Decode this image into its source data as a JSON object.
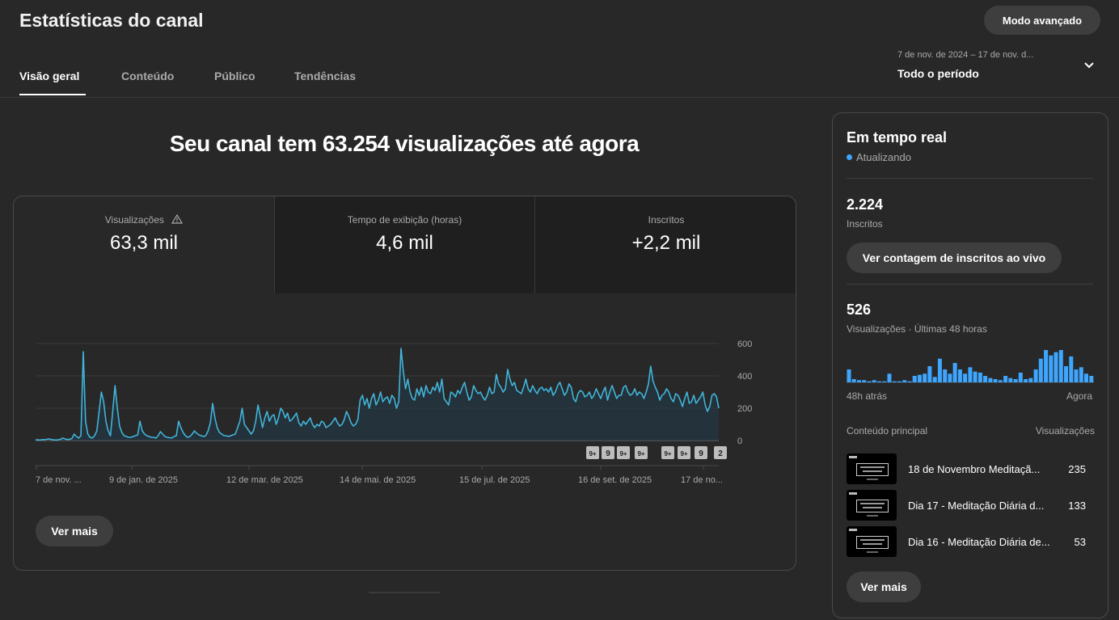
{
  "header": {
    "title": "Estatísticas do canal",
    "advanced_mode": "Modo avançado"
  },
  "tabs": [
    {
      "label": "Visão geral",
      "active": true
    },
    {
      "label": "Conteúdo",
      "active": false
    },
    {
      "label": "Público",
      "active": false
    },
    {
      "label": "Tendências",
      "active": false
    }
  ],
  "date_range": {
    "range": "7 de nov. de 2024 – 17 de nov. d...",
    "period": "Todo o período"
  },
  "headline": "Seu canal tem 63.254 visualizações até agora",
  "metrics": [
    {
      "label": "Visualizações",
      "value": "63,3 mil",
      "warning": true,
      "selected": true
    },
    {
      "label": "Tempo de exibição (horas)",
      "value": "4,6 mil",
      "warning": false,
      "selected": false
    },
    {
      "label": "Inscritos",
      "value": "+2,2 mil",
      "warning": false,
      "selected": false
    }
  ],
  "colors": {
    "accent": "#3ea6ff",
    "line": "#41b4d9",
    "background": "#282828",
    "card_dark": "#1f1f1f"
  },
  "chart_data": {
    "type": "area",
    "x_tick_labels": [
      "7 de nov. ...",
      "9 de jan. de 2025",
      "12 de mar. de 2025",
      "14 de mai. de 2025",
      "15 de jul. de 2025",
      "16 de set. de 2025",
      "17 de no..."
    ],
    "y_ticks": [
      0,
      200,
      400,
      600
    ],
    "ylim": [
      0,
      600
    ],
    "series": [
      {
        "values": [
          5,
          4,
          3,
          6,
          5,
          8,
          10,
          6,
          4,
          3,
          5,
          8,
          15,
          10,
          6,
          8,
          12,
          40,
          25,
          15,
          30,
          550,
          120,
          40,
          20,
          15,
          30,
          60,
          180,
          300,
          240,
          120,
          60,
          30,
          180,
          340,
          200,
          90,
          50,
          30,
          25,
          20,
          20,
          25,
          30,
          35,
          120,
          60,
          40,
          30,
          25,
          20,
          20,
          15,
          30,
          55,
          40,
          25,
          20,
          18,
          15,
          25,
          30,
          120,
          80,
          50,
          30,
          20,
          25,
          40,
          60,
          45,
          35,
          30,
          25,
          30,
          60,
          110,
          230,
          140,
          80,
          50,
          40,
          30,
          30,
          25,
          30,
          35,
          40,
          80,
          120,
          200,
          100,
          80,
          60,
          40,
          60,
          120,
          220,
          150,
          80,
          140,
          180,
          120,
          150,
          160,
          100,
          140,
          200,
          180,
          140,
          170,
          120,
          130,
          150,
          170,
          110,
          90,
          120,
          100,
          120,
          140,
          100,
          80,
          100,
          90,
          120,
          110,
          80,
          90,
          100,
          120,
          140,
          110,
          90,
          100,
          130,
          180,
          150,
          110,
          90,
          100,
          130,
          250,
          280,
          220,
          260,
          200,
          260,
          290,
          220,
          250,
          300,
          240,
          260,
          270,
          230,
          280,
          260,
          200,
          240,
          570,
          430,
          320,
          380,
          300,
          260,
          250,
          320,
          280,
          330,
          270,
          340,
          300,
          290,
          330,
          310,
          360,
          300,
          380,
          260,
          240,
          220,
          300,
          290,
          270,
          310,
          290,
          330,
          360,
          300,
          250,
          270,
          340,
          310,
          290,
          300,
          270,
          250,
          280,
          330,
          290,
          300,
          410,
          350,
          330,
          300,
          320,
          440,
          380,
          340,
          360,
          310,
          300,
          290,
          330,
          380,
          320,
          300,
          340,
          310,
          290,
          320,
          330,
          310,
          320,
          300,
          330,
          280,
          300,
          340,
          360,
          320,
          280,
          300,
          350,
          330,
          260,
          240,
          290,
          310,
          300,
          270,
          280,
          300,
          260,
          280,
          320,
          290,
          260,
          300,
          330,
          250,
          300,
          340,
          300,
          260,
          280,
          280,
          330,
          340,
          300,
          280,
          290,
          320,
          280,
          300,
          290,
          260,
          300,
          350,
          460,
          370,
          330,
          300,
          250,
          280,
          290,
          320,
          300,
          260,
          240,
          290,
          280,
          250,
          210,
          260,
          300,
          230,
          240,
          280,
          230,
          250,
          270,
          300,
          220,
          180,
          210,
          280,
          290,
          270,
          200
        ]
      }
    ],
    "markers": [
      "9+",
      "9",
      "9+",
      "9+",
      "9+",
      "9+",
      "9",
      "2"
    ]
  },
  "see_more": "Ver mais",
  "realtime": {
    "title": "Em tempo real",
    "status": "Atualizando",
    "subscribers_value": "2.224",
    "subscribers_label": "Inscritos",
    "live_button": "Ver contagem de inscritos ao vivo",
    "views_value": "526",
    "views_label": "Visualizações · Últimas 48 horas",
    "bars_from": "48h atrás",
    "bars_to": "Agora",
    "hourly_views": [
      12,
      3,
      2,
      2,
      1,
      2,
      1,
      1,
      8,
      1,
      1,
      2,
      1,
      6,
      7,
      8,
      15,
      5,
      22,
      12,
      8,
      18,
      12,
      8,
      14,
      10,
      9,
      6,
      4,
      3,
      2,
      6,
      4,
      3,
      9,
      3,
      4,
      12,
      22,
      30,
      25,
      28,
      30,
      15,
      24,
      12,
      14,
      8,
      6
    ],
    "content_label": "Conteúdo principal",
    "views_column": "Visualizações",
    "videos": [
      {
        "title": "18 de Novembro Meditaçã...",
        "views": "235"
      },
      {
        "title": "Dia 17 - Meditação Diária d...",
        "views": "133"
      },
      {
        "title": "Dia 16 - Meditação Diária de...",
        "views": "53"
      }
    ],
    "see_more": "Ver mais"
  }
}
